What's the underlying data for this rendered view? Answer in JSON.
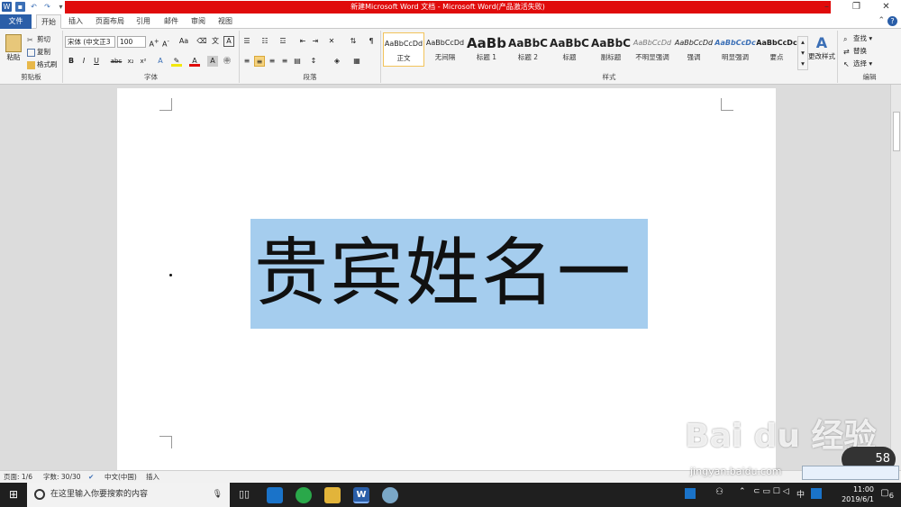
{
  "window": {
    "title": "新建Microsoft Word 文档 - Microsoft Word(产品激活失败)"
  },
  "tabs": [
    "文件",
    "开始",
    "插入",
    "页面布局",
    "引用",
    "邮件",
    "审阅",
    "视图"
  ],
  "clipboard": {
    "paste": "粘贴",
    "cut": "剪切",
    "copy": "复制",
    "format_painter": "格式刷",
    "label": "剪贴板"
  },
  "font": {
    "name": "宋体 (中文正3",
    "size": "100",
    "label": "字体",
    "bold": "B",
    "italic": "I",
    "underline": "U",
    "strike": "abc",
    "sub": "x₂",
    "sup": "x²",
    "color_a": "A"
  },
  "paragraph": {
    "label": "段落"
  },
  "styles": {
    "label": "样式",
    "items": [
      {
        "preview": "AaBbCcDd",
        "name": "正文"
      },
      {
        "preview": "AaBbCcDd",
        "name": "无间隔"
      },
      {
        "preview": "AaBb",
        "name": "标题 1"
      },
      {
        "preview": "AaBbC",
        "name": "标题 2"
      },
      {
        "preview": "AaBbC",
        "name": "标题"
      },
      {
        "preview": "AaBbC",
        "name": "副标题"
      },
      {
        "preview": "AaBbCcDd",
        "name": "不明显强调"
      },
      {
        "preview": "AaBbCcDd",
        "name": "强调"
      },
      {
        "preview": "AaBbCcDc",
        "name": "明显强调"
      },
      {
        "preview": "AaBbCcDc",
        "name": "要点"
      }
    ],
    "change_styles": "更改样式"
  },
  "editing": {
    "find": "查找",
    "replace": "替换",
    "select": "选择",
    "label": "编辑"
  },
  "document": {
    "text": "贵宾姓名一"
  },
  "status": {
    "page": "页面: 1/6",
    "words": "字数: 30/30",
    "lang": "中文(中国)",
    "mode": "插入"
  },
  "taskbar": {
    "search_placeholder": "在这里输入你要搜索的内容",
    "time": "11:00",
    "date": "2019/6/1",
    "ime": "中",
    "notif_count": "6"
  },
  "watermark": {
    "logo": "Bai du 经验",
    "url": "jingyan.baidu.com",
    "speed": "58"
  }
}
